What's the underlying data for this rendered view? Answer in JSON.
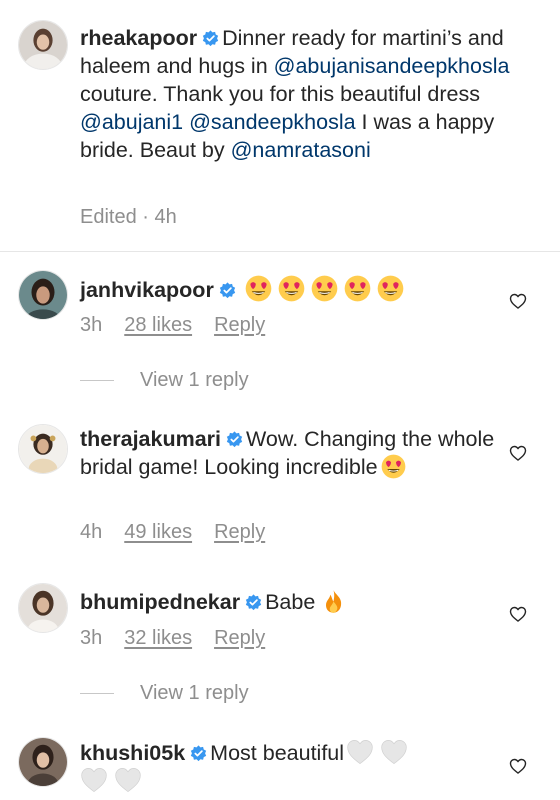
{
  "caption": {
    "username": "rheakapoor",
    "text_1": "Dinner ready for martini’s and haleem and hugs in ",
    "mention_1": "@abujanisandeepkhosla",
    "text_2": " couture. Thank you for this beautiful dress ",
    "mention_2": "@abujani1",
    "text_3": " ",
    "mention_3": "@sandeepkhosla",
    "text_4": " I was a happy bride. Beaut by ",
    "mention_4": "@namratasoni",
    "meta": "Edited · 4h"
  },
  "comments": [
    {
      "username": "janhvikapoor",
      "emoji_name": "heart-eyes-emoji",
      "emoji_count": 5,
      "time": "3h",
      "likes": "28 likes",
      "reply": "Reply",
      "view_replies": "View 1 reply"
    },
    {
      "username": "therajakumari",
      "text": "Wow. Changing the whole bridal game! Looking incredible",
      "emoji_name": "heart-eyes-emoji",
      "time": "4h",
      "likes": "49 likes",
      "reply": "Reply"
    },
    {
      "username": "bhumipednekar",
      "text": "Babe",
      "emoji_name": "fire-emoji",
      "time": "3h",
      "likes": "32 likes",
      "reply": "Reply",
      "view_replies": "View 1 reply"
    },
    {
      "username": "khushi05k",
      "text": "Most beautiful",
      "emoji_name": "white-heart-emoji",
      "emoji_count": 4
    }
  ],
  "colors": {
    "text": "#262626",
    "secondary": "#8e8e8e",
    "mention": "#00376b",
    "verified": "#3897f0"
  }
}
